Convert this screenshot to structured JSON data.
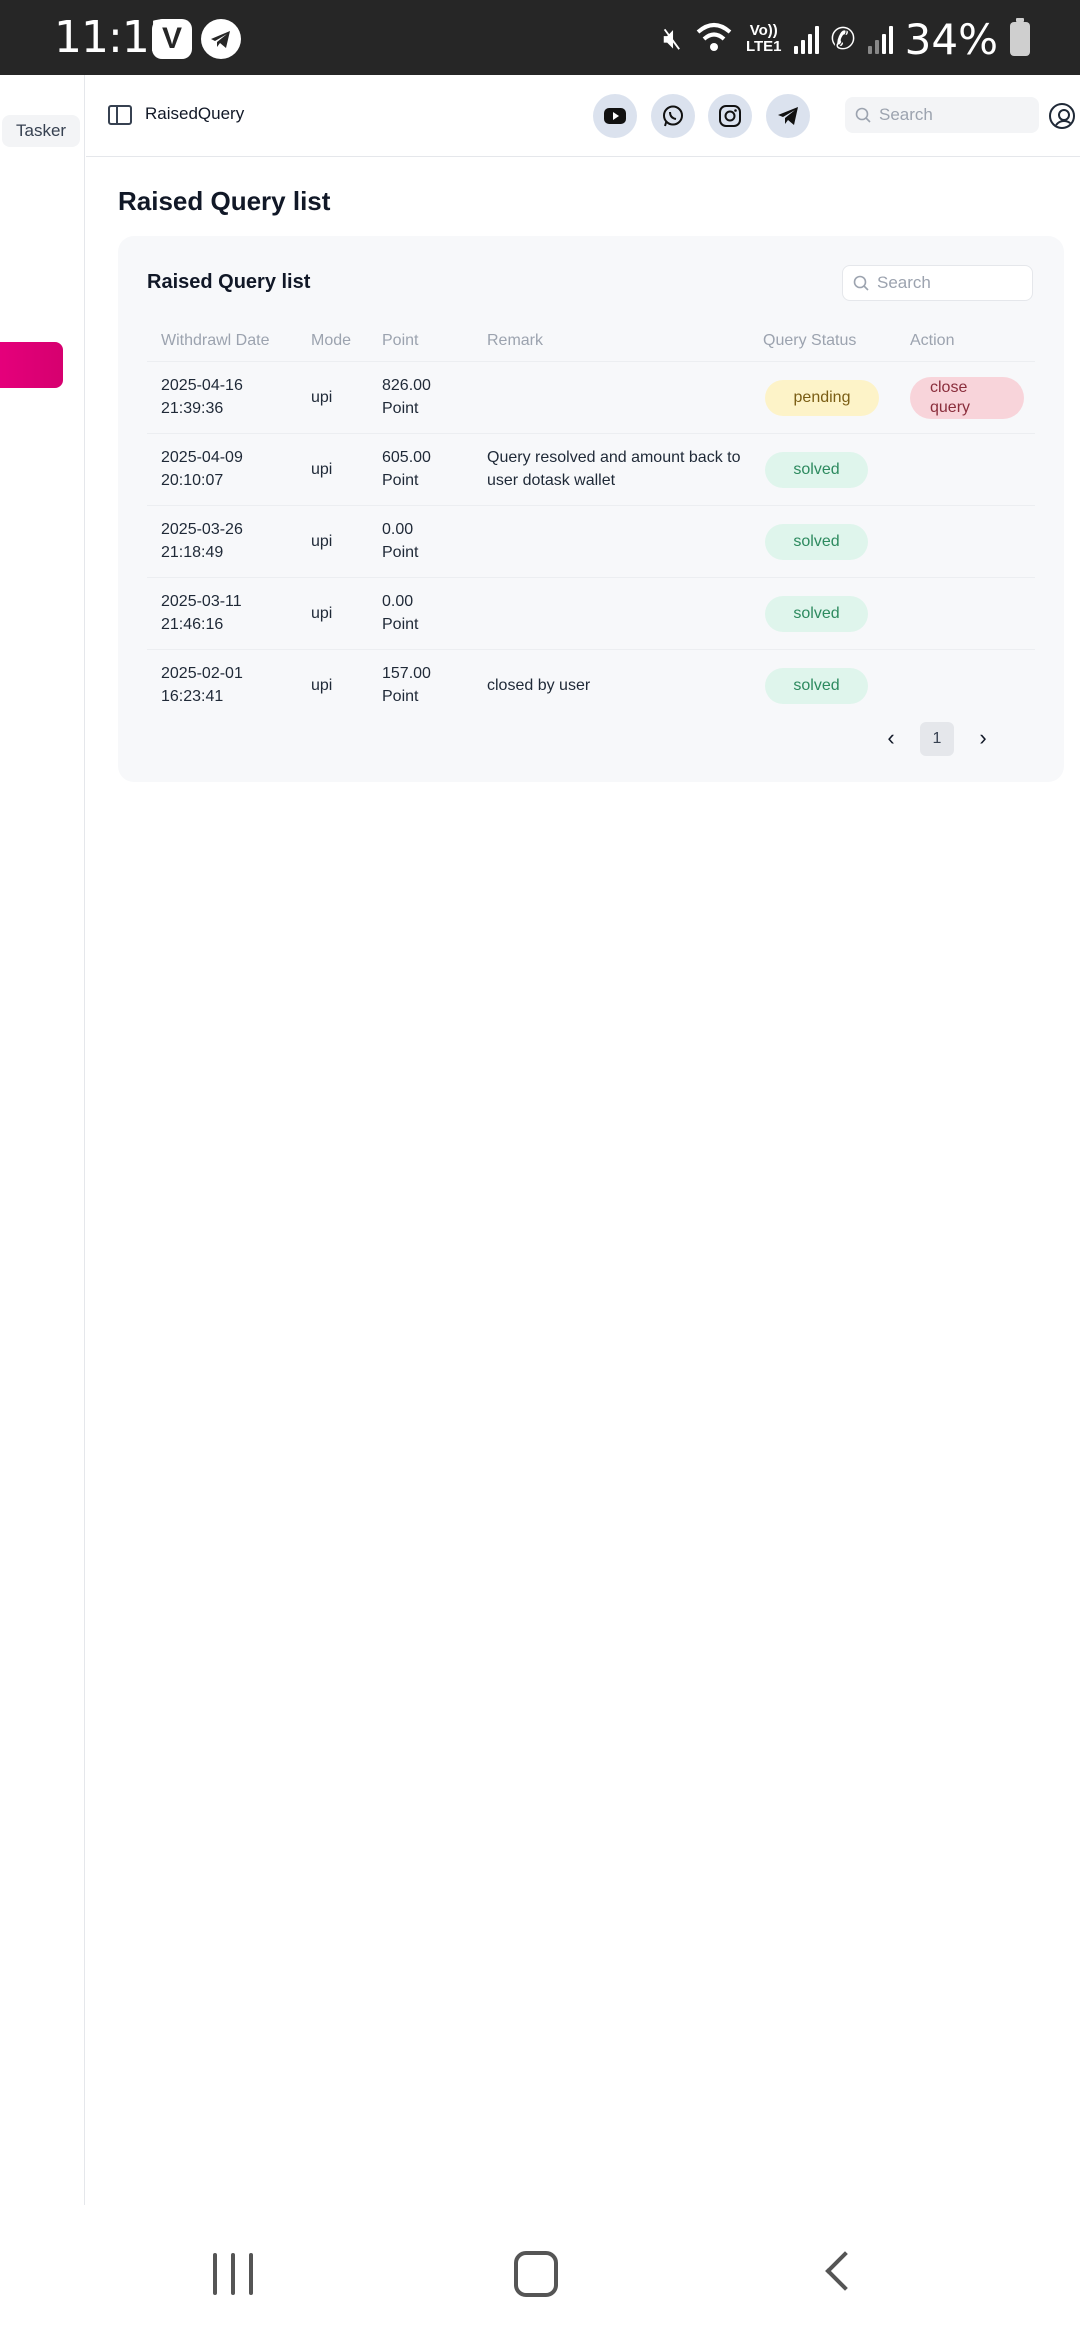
{
  "status_bar": {
    "time": "11:13",
    "app_icons": [
      "vivo-icon",
      "telegram-icon"
    ],
    "volte_label_top": "Vo))",
    "volte_label_bottom": "LTE1",
    "battery_percent": "34%"
  },
  "sidebar": {
    "brand": "Tasker",
    "accent_color": "#e7007d"
  },
  "header": {
    "page_name": "RaisedQuery",
    "social_icons": [
      "youtube-icon",
      "whatsapp-icon",
      "instagram-icon",
      "telegram-icon"
    ],
    "search_placeholder": "Search"
  },
  "main": {
    "title": "Raised Query list",
    "card": {
      "title": "Raised Query list",
      "search_placeholder": "Search",
      "columns": [
        "Withdrawl Date",
        "Mode",
        "Point",
        "Remark",
        "Query Status",
        "Action"
      ],
      "rows": [
        {
          "date": "2025-04-16",
          "time": "21:39:36",
          "mode": "upi",
          "point": "826.00",
          "unit": "Point",
          "remark": "",
          "status": "pending",
          "action_line1": "close",
          "action_line2": "query"
        },
        {
          "date": "2025-04-09",
          "time": "20:10:07",
          "mode": "upi",
          "point": "605.00",
          "unit": "Point",
          "remark": "Query resolved and amount back to user dotask wallet",
          "status": "solved"
        },
        {
          "date": "2025-03-26",
          "time": "21:18:49",
          "mode": "upi",
          "point": "0.00",
          "unit": "Point",
          "remark": "",
          "status": "solved"
        },
        {
          "date": "2025-03-11",
          "time": "21:46:16",
          "mode": "upi",
          "point": "0.00",
          "unit": "Point",
          "remark": "",
          "status": "solved"
        },
        {
          "date": "2025-02-01",
          "time": "16:23:41",
          "mode": "upi",
          "point": "157.00",
          "unit": "Point",
          "remark": "closed by user",
          "status": "solved"
        }
      ],
      "pagination": {
        "current_page": "1",
        "prev_icon": "chevron-left-icon",
        "next_icon": "chevron-right-icon"
      }
    }
  }
}
